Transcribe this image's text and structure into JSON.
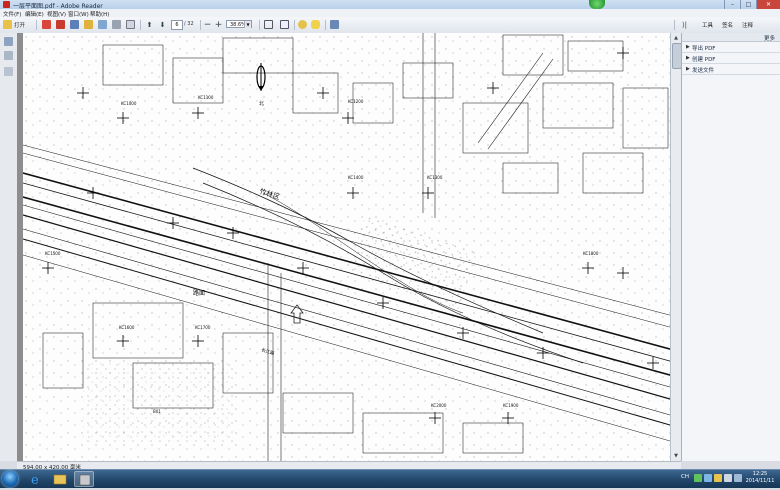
{
  "window": {
    "title": "一层平面图.pdf - Adobe Reader"
  },
  "menu": {
    "items": [
      "文件(F)",
      "编辑(E)",
      "视图(V)",
      "窗口(W)",
      "帮助(H)"
    ]
  },
  "toolbar": {
    "open_label": "打开",
    "page_current": "6",
    "page_total": "/ 32",
    "zoom": "38.6%",
    "tools_label": "工具",
    "sign_label": "签名",
    "comment_label": "注释"
  },
  "rightpanel": {
    "header": "更多",
    "items": [
      {
        "label": "导出 PDF"
      },
      {
        "label": "创建 PDF"
      },
      {
        "label": "发送文件"
      }
    ]
  },
  "statusbar": {
    "text": "594.00 x 420.00 毫米"
  },
  "taskbar": {
    "lang": "CH",
    "time": "12:25",
    "date": "2014/11/11"
  },
  "drawing": {
    "labels": [
      "竹林区",
      "长江路",
      "KC1000",
      "KC1100",
      "KC1200",
      "KC1300",
      "KC1400",
      "KC1500",
      "KC1600",
      "KC1700",
      "KC1800",
      "KC1900",
      "KC2000",
      "路面",
      "北",
      "B01"
    ],
    "north_label": "北"
  },
  "colors": {
    "titlebar": "#c3d7ee",
    "taskbar": "#1f4467",
    "close": "#c9463d"
  }
}
